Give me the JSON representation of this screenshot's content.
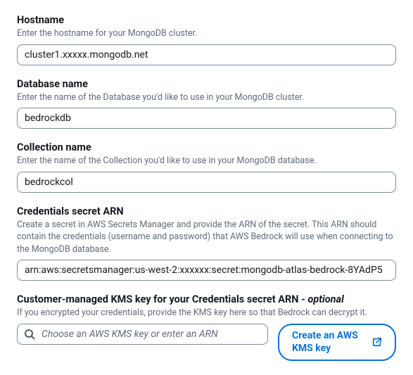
{
  "hostname": {
    "label": "Hostname",
    "description": "Enter the hostname for your MongoDB cluster.",
    "value": "cluster1.xxxxx.mongodb.net"
  },
  "database": {
    "label": "Database name",
    "description": "Enter the name of the Database you'd like to use in your MongoDB cluster.",
    "value": "bedrockdb"
  },
  "collection": {
    "label": "Collection name",
    "description": "Enter the name of the Collection you'd like to use in your MongoDB database.",
    "value": "bedrockcol"
  },
  "credentials": {
    "label": "Credentials secret ARN",
    "description": "Create a secret in AWS Secrets Manager and provide the ARN of the secret. This ARN should contain the credentials (username and password) that AWS Bedrock will use when connecting to the MongoDB database.",
    "value": "arn:aws:secretsmanager:us-west-2:xxxxxx:secret:mongodb-atlas-bedrock-8YAdP5"
  },
  "kms": {
    "label_prefix": "Customer-managed KMS key for your Credentials secret ARN ",
    "label_sep": "- ",
    "optional_tag": "optional",
    "description": "If you encrypted your credentials, provide the KMS key here so that Bedrock can decrypt it.",
    "placeholder": "Choose an AWS KMS key or enter an ARN",
    "button_label": "Create an AWS KMS key"
  }
}
